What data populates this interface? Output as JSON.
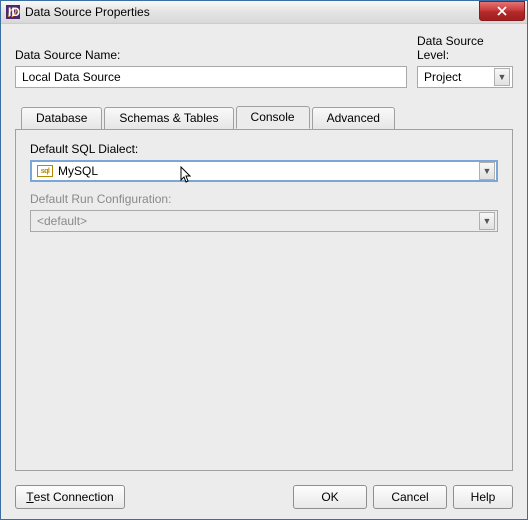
{
  "window": {
    "title": "Data Source Properties"
  },
  "form": {
    "name_label": "Data Source Name:",
    "name_value": "Local Data Source",
    "level_label": "Data Source Level:",
    "level_value": "Project"
  },
  "tabs": {
    "database": "Database",
    "schemas": "Schemas & Tables",
    "console": "Console",
    "advanced": "Advanced",
    "active": "console"
  },
  "console": {
    "dialect_label": "Default SQL Dialect:",
    "dialect_value": "MySQL",
    "runcfg_label": "Default Run Configuration:",
    "runcfg_value": "<default>"
  },
  "buttons": {
    "test": "est Connection",
    "test_ul": "T",
    "ok": "OK",
    "cancel": "Cancel",
    "help": "Help"
  }
}
